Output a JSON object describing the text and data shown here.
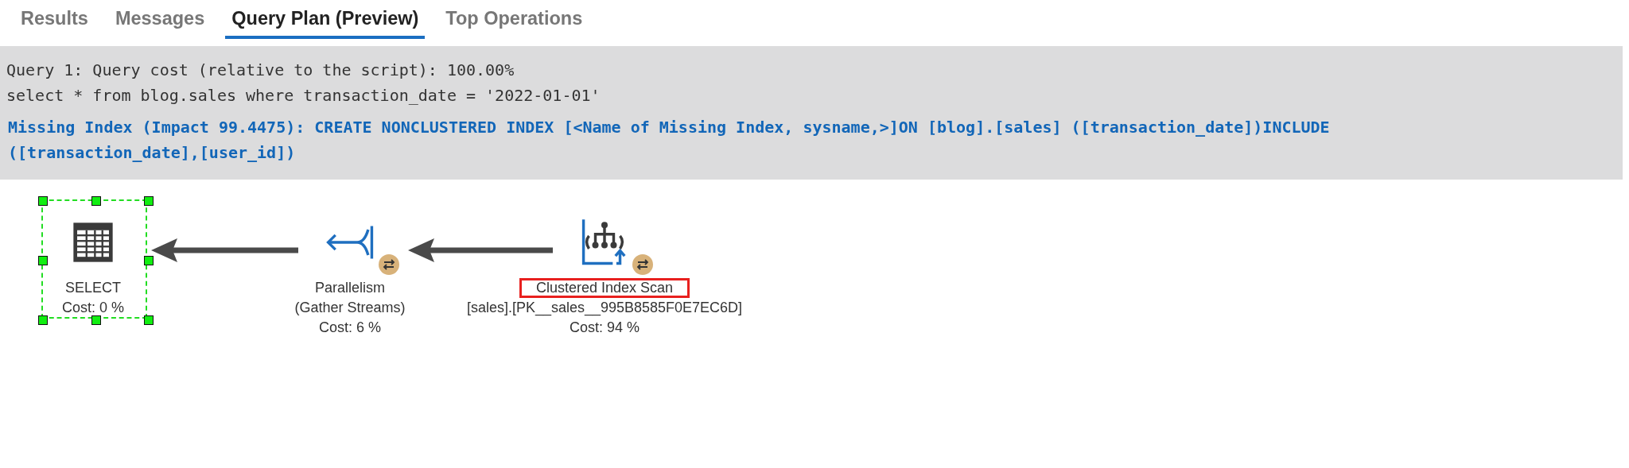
{
  "tabs": [
    {
      "label": "Results",
      "selected": false
    },
    {
      "label": "Messages",
      "selected": false
    },
    {
      "label": "Query Plan (Preview)",
      "selected": true
    },
    {
      "label": "Top Operations",
      "selected": false
    }
  ],
  "query_header": {
    "lines": [
      "Query 1: Query cost (relative to the script): 100.00%",
      "select * from blog.sales where transaction_date = '2022-01-01'"
    ],
    "missing_index": "Missing Index (Impact 99.4475): CREATE NONCLUSTERED INDEX [<Name of Missing Index, sysname,>]ON [blog].[sales] ([transaction_date])INCLUDE ([transaction_date],[user_id])"
  },
  "plan_nodes": [
    {
      "kind": "select",
      "selected": true,
      "parallel": false,
      "labels": [
        {
          "text": "SELECT",
          "highlighted": false
        },
        {
          "text": "Cost: 0 %",
          "highlighted": false
        }
      ]
    },
    {
      "kind": "parallelism",
      "selected": false,
      "parallel": true,
      "labels": [
        {
          "text": "Parallelism",
          "highlighted": false
        },
        {
          "text": "(Gather Streams)",
          "highlighted": false
        },
        {
          "text": "Cost: 6 %",
          "highlighted": false
        }
      ]
    },
    {
      "kind": "clustered_index_scan",
      "selected": false,
      "parallel": true,
      "labels": [
        {
          "text": "Clustered Index Scan",
          "highlighted": true
        },
        {
          "text": "[sales].[PK__sales__995B8585F0E7EC6D]",
          "highlighted": false
        },
        {
          "text": "Cost: 94 %",
          "highlighted": false
        }
      ]
    }
  ]
}
